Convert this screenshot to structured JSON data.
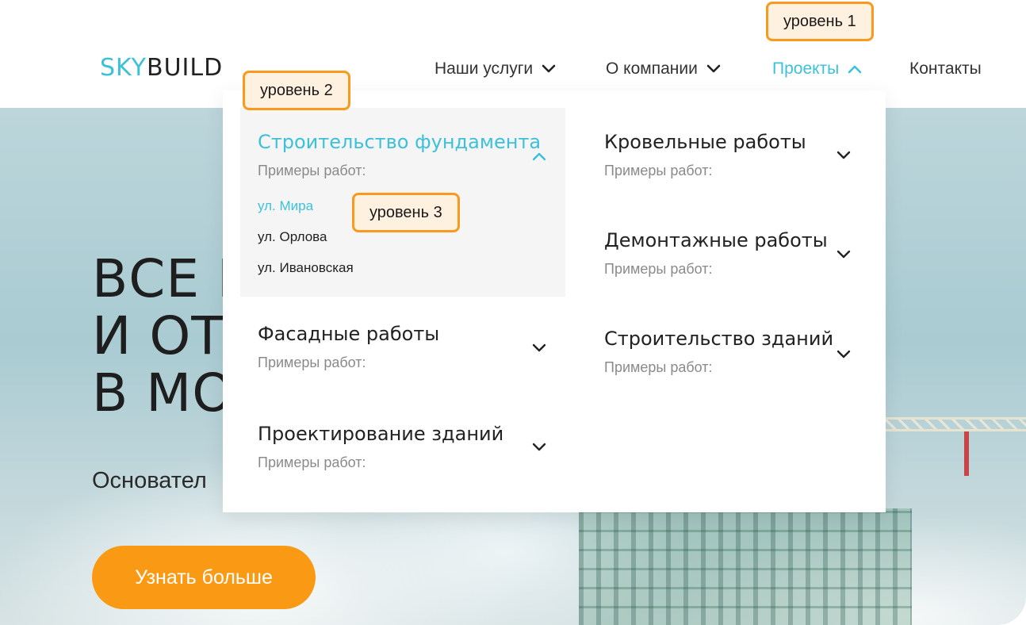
{
  "header": {
    "logo": {
      "part1": "SKY",
      "part2": "BUILD"
    },
    "nav": [
      {
        "label": "Наши услуги"
      },
      {
        "label": "О компании"
      },
      {
        "label": "Проекты"
      },
      {
        "label": "Контакты"
      }
    ]
  },
  "hero": {
    "title_lines": [
      "ВСЕ Е",
      "И ОТД",
      "В МО"
    ],
    "subtitle": "Основател",
    "cta_label": "Узнать больше"
  },
  "dropdown": {
    "categories": [
      {
        "title": "Строительство фундамента",
        "sub": "Примеры работ:",
        "items": [
          "ул. Мира",
          "ул. Орлова",
          "ул. Ивановская"
        ]
      },
      {
        "title": "Фасадные работы",
        "sub": "Примеры работ:"
      },
      {
        "title": "Проектирование зданий",
        "sub": "Примеры работ:"
      },
      {
        "title": "Кровельные работы",
        "sub": "Примеры работ:"
      },
      {
        "title": "Демонтажные работы",
        "sub": "Примеры работ:"
      },
      {
        "title": "Строительство зданий",
        "sub": "Примеры работ:"
      }
    ]
  },
  "badges": {
    "level1": "уровень 1",
    "level2": "уровень 2",
    "level3": "уровень 3"
  },
  "colors": {
    "accent": "#3cc1d9",
    "cta": "#fa9a14",
    "badge_border": "#f79a1e",
    "badge_fill": "#fff1df"
  },
  "icons": [
    "chevron-down-icon",
    "chevron-up-icon"
  ]
}
